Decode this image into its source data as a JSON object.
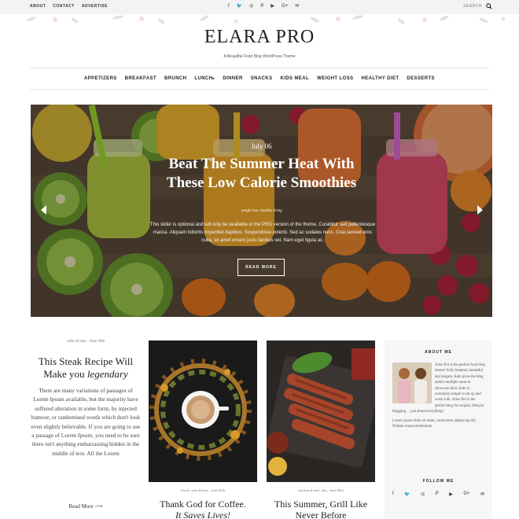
{
  "topbar": {
    "links": [
      "ABOUT",
      "CONTACT",
      "ADVERTISE"
    ],
    "social": [
      "f",
      "🐦",
      "◎",
      "P",
      "▶",
      "G+",
      "✉"
    ],
    "search_label": "SEARCH"
  },
  "brand": {
    "title": "ELARA PRO",
    "tagline": "A Beautiful Food Blog WordPress Theme"
  },
  "nav": {
    "items": [
      "APPETIZERS",
      "BREAKFAST",
      "BRUNCH",
      "LUNCH",
      "DINNER",
      "SNACKS",
      "KIDS MEAL",
      "WEIGHT LOSS",
      "HEALTHY DIET",
      "DESSERTS"
    ]
  },
  "slider": {
    "date": "July 06",
    "title_line1": "Beat The Summer Heat With",
    "title_line2": "These Low Calorie Smoothies",
    "categories": "weight loss, healthy living",
    "text": "This slider is optional and will only be available in the PRO version of the theme. Curabitur sed pellentesque massa. Aliquam lobortis imperdiet dapibus. Suspendisse potenti. Sed ac sodales nunc. Cras laoreet eros nulla, sit amet ornare justo facilisis vel. Nam eget ligula ac.",
    "button": "READ MORE"
  },
  "post1": {
    "meta": "cafes & bars  ·  June 06th",
    "title_line1": "This Steak Recipe Will",
    "title_line2a": "Make you ",
    "title_line2b": "legendary",
    "excerpt": "There are many variations of passages of Lorem Ipsum available, but the majority have suffered alteration in some form, by injected humour, or randomised words which don't look even slightly believable. If you are going to use a passage of Lorem Ipsum, you need to be sure there isn't anything embarrassing hidden in the middle of text. All the Lorem",
    "read_more": "Read More"
  },
  "post2": {
    "meta": "travel, cafes & bars  ·  June 06th",
    "title_line1": "Thank God for Coffee.",
    "title_line2": "It Saves Lives!"
  },
  "post3": {
    "meta": "chicken & beef, bbq  ·  June 06th",
    "title_line1": "This Summer, Grill Like",
    "title_line2": "Never Before"
  },
  "sidebar": {
    "about_heading": "ABOUT ME",
    "about_p1": "Aries Pro is the perfect food blog theme! Fully featured, beautiful and elegant, Kale gives the blog author multiple areas to showcase their. Kale is extremely simple to set up and work with. Aries Pro is the perfect blog for recipes, lifestyle blogging… just about everything!",
    "about_p2": "Lorem ipsum dolor sit amet, consectetur adipiscing elit. Nullam ornare elementum",
    "follow_heading": "FOLLOW ME",
    "social": [
      "f",
      "🐦",
      "◎",
      "P",
      "▶",
      "G+",
      "✉"
    ]
  }
}
